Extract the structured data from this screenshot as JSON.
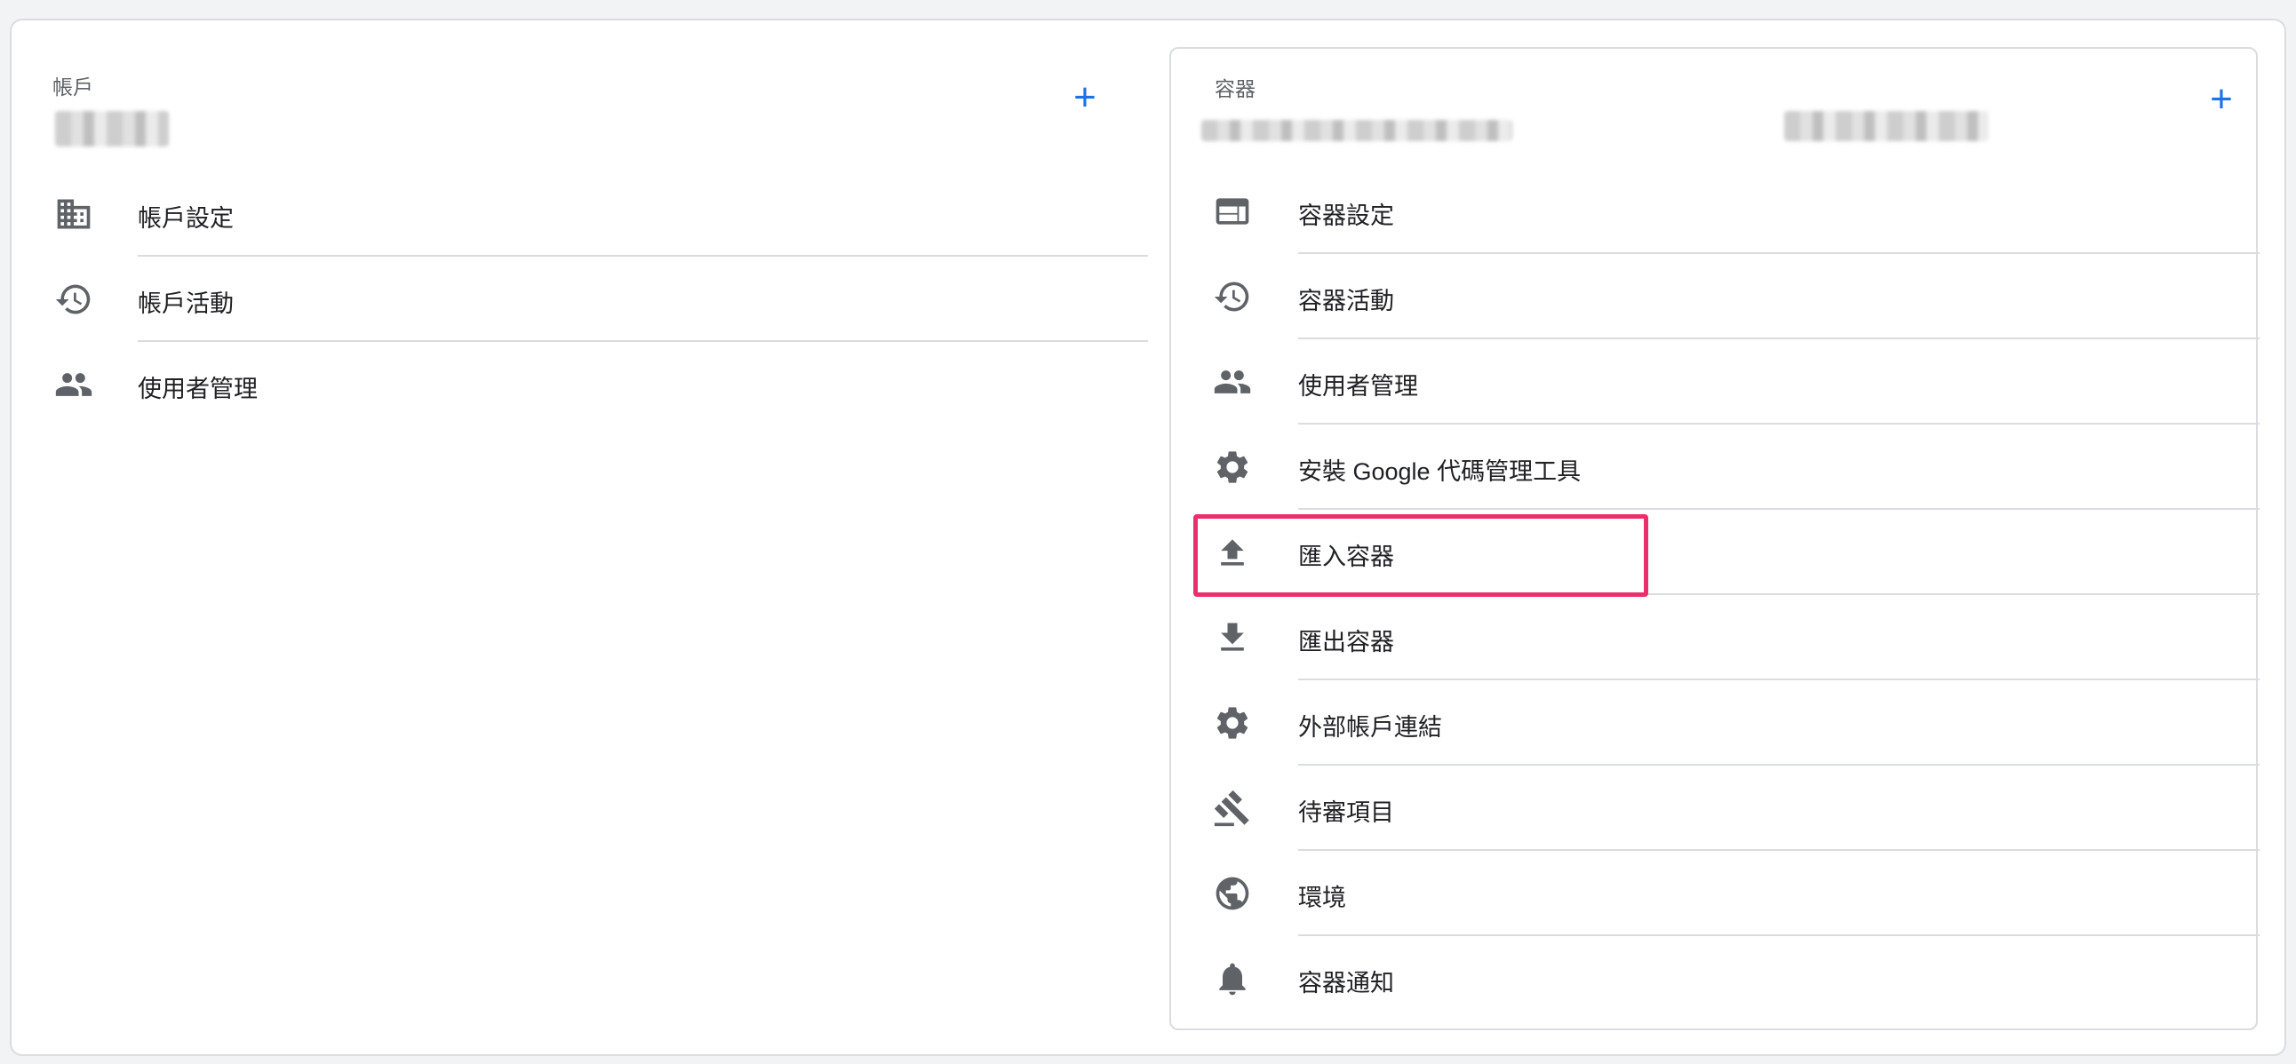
{
  "account_panel": {
    "title": "帳戶",
    "add_label": "+",
    "items": [
      {
        "label": "帳戶設定",
        "icon": "building-icon"
      },
      {
        "label": "帳戶活動",
        "icon": "history-icon"
      },
      {
        "label": "使用者管理",
        "icon": "people-icon"
      }
    ]
  },
  "container_panel": {
    "title": "容器",
    "add_label": "+",
    "items": [
      {
        "label": "容器設定",
        "icon": "web-layout-icon"
      },
      {
        "label": "容器活動",
        "icon": "history-icon"
      },
      {
        "label": "使用者管理",
        "icon": "people-icon"
      },
      {
        "label": "安裝 Google 代碼管理工具",
        "icon": "gear-icon"
      },
      {
        "label": "匯入容器",
        "icon": "upload-icon"
      },
      {
        "label": "匯出容器",
        "icon": "download-icon"
      },
      {
        "label": "外部帳戶連結",
        "icon": "gear-icon"
      },
      {
        "label": "待審項目",
        "icon": "gavel-icon"
      },
      {
        "label": "環境",
        "icon": "globe-icon"
      },
      {
        "label": "容器通知",
        "icon": "bell-icon"
      }
    ]
  },
  "colors": {
    "accent": "#1a73e8",
    "highlight": "#e8306d",
    "icon": "#5f6368"
  }
}
